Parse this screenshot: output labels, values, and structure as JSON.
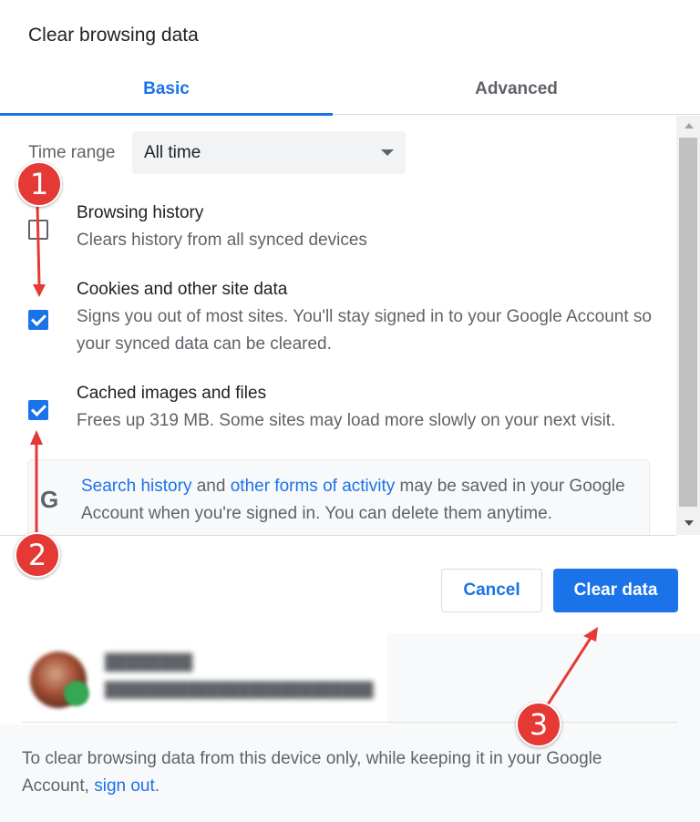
{
  "dialog": {
    "title": "Clear browsing data",
    "tabs": [
      {
        "label": "Basic",
        "selected": true
      },
      {
        "label": "Advanced",
        "selected": false
      }
    ]
  },
  "time_range": {
    "label": "Time range",
    "selected": "All time"
  },
  "items": [
    {
      "title": "Browsing history",
      "description": "Clears history from all synced devices",
      "checked": false
    },
    {
      "title": "Cookies and other site data",
      "description": "Signs you out of most sites. You'll stay signed in to your Google Account so your synced data can be cleared.",
      "checked": true
    },
    {
      "title": "Cached images and files",
      "description": "Frees up 319 MB. Some sites may load more slowly on your next visit.",
      "checked": true
    }
  ],
  "google_notice": {
    "icon": "G",
    "link1": "Search history",
    "text1": " and ",
    "link2": "other forms of activity",
    "text2": " may be saved in your Google Account when you're signed in. You can delete them anytime."
  },
  "buttons": {
    "cancel": "Cancel",
    "clear": "Clear data"
  },
  "account": {
    "signout_text": "To clear browsing data from this device only, while keeping it in your Google Account, ",
    "signout_link": "sign out",
    "signout_end": "."
  },
  "annotations": [
    "1",
    "2",
    "3"
  ],
  "colors": {
    "accent": "#1a73e8",
    "marker": "#e53935"
  }
}
